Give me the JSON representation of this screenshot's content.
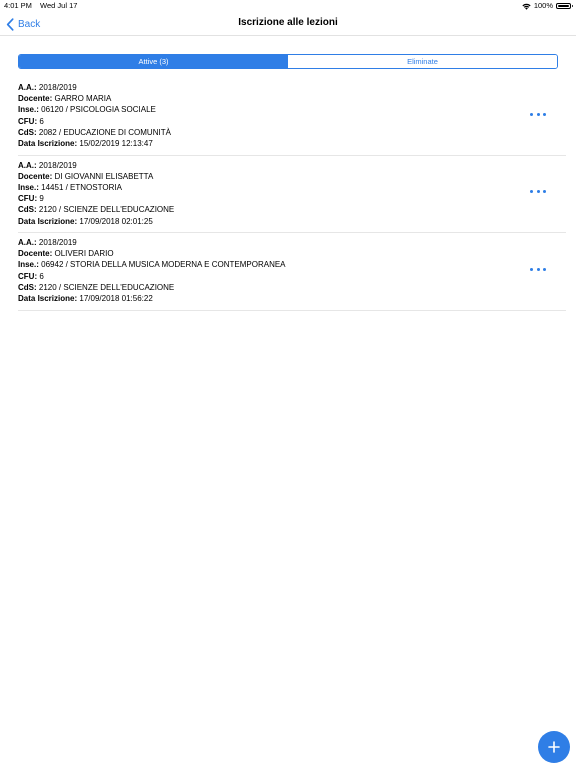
{
  "status_bar": {
    "time": "4:01 PM",
    "date": "Wed Jul 17",
    "battery": "100%"
  },
  "nav": {
    "back_label": "Back",
    "title": "Iscrizione alle lezioni"
  },
  "segments": [
    {
      "label": "Attive (3)",
      "selected": true
    },
    {
      "label": "Eliminate",
      "selected": false
    }
  ],
  "field_labels": {
    "aa": "A.A.:",
    "docente": "Docente:",
    "inse": "Inse.:",
    "cfu": "CFU:",
    "cds": "CdS:",
    "data": "Data Iscrizione:"
  },
  "items": [
    {
      "aa": "2018/2019",
      "docente": "GARRO MARIA",
      "inse": "06120 / PSICOLOGIA SOCIALE",
      "cfu": "6",
      "cds": "2082 / EDUCAZIONE DI COMUNITÀ",
      "data": "15/02/2019 12:13:47"
    },
    {
      "aa": "2018/2019",
      "docente": "DI GIOVANNI ELISABETTA",
      "inse": "14451 / ETNOSTORIA",
      "cfu": "9",
      "cds": "2120 / SCIENZE DELL'EDUCAZIONE",
      "data": "17/09/2018 02:01:25"
    },
    {
      "aa": "2018/2019",
      "docente": "OLIVERI DARIO",
      "inse": "06942 / STORIA DELLA MUSICA MODERNA E CONTEMPORANEA",
      "cfu": "6",
      "cds": "2120 / SCIENZE DELL'EDUCAZIONE",
      "data": "17/09/2018 01:56:22"
    }
  ],
  "colors": {
    "accent": "#2f7ee6",
    "separator": "#e6e6e6"
  },
  "icons": {
    "back": "chevron-left-icon",
    "more": "more-dots-icon",
    "add": "plus-icon",
    "wifi": "wifi-icon",
    "battery": "battery-icon"
  }
}
